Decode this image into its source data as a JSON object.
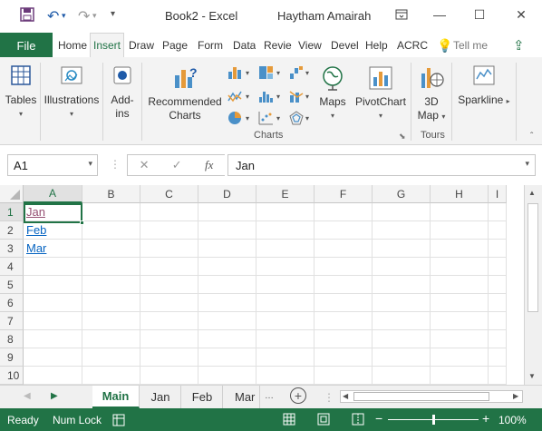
{
  "titlebar": {
    "doc_title": "Book2  -  Excel",
    "user": "Haytham Amairah",
    "save_icon": "save-icon",
    "undo_icon": "undo-icon",
    "redo_icon": "redo-icon"
  },
  "ribbon_tabs": {
    "file": "File",
    "tabs": [
      "Home",
      "Insert",
      "Draw",
      "Page",
      "Form",
      "Data",
      "Revie",
      "View",
      "Devel",
      "Help",
      "ACRC"
    ],
    "active": "Insert",
    "tell_me": "Tell me"
  },
  "ribbon": {
    "tables": "Tables",
    "illustrations": "Illustrations",
    "addins_line1": "Add-",
    "addins_line2": "ins",
    "recommended_line1": "Recommended",
    "recommended_line2": "Charts",
    "maps": "Maps",
    "pivotchart": "PivotChart",
    "map3d_line1": "3D",
    "map3d_line2": "Map",
    "sparklines": "Sparkline",
    "group_charts": "Charts",
    "group_tours": "Tours"
  },
  "formula": {
    "namebox": "A1",
    "fx": "fx",
    "value": "Jan"
  },
  "grid": {
    "columns": [
      "A",
      "B",
      "C",
      "D",
      "E",
      "F",
      "G",
      "H",
      "I"
    ],
    "rows": [
      "1",
      "2",
      "3",
      "4",
      "5",
      "6",
      "7",
      "8",
      "9",
      "10"
    ],
    "cells": [
      {
        "row": "1",
        "col": "A",
        "value": "Jan"
      },
      {
        "row": "2",
        "col": "A",
        "value": "Feb"
      },
      {
        "row": "3",
        "col": "A",
        "value": "Mar"
      }
    ]
  },
  "sheets": {
    "tabs": [
      "Main",
      "Jan",
      "Feb",
      "Mar"
    ],
    "active": "Main"
  },
  "status": {
    "ready": "Ready",
    "numlock": "Num Lock",
    "zoom": "100%"
  },
  "colors": {
    "accent": "#217346",
    "link": "#0563c1"
  }
}
